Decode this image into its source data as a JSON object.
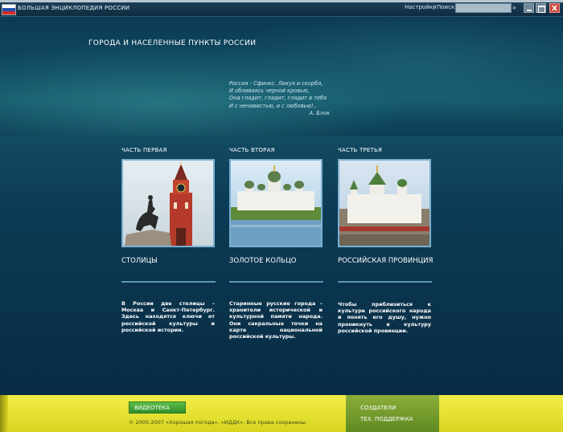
{
  "titlebar": {
    "app_title": "БОЛЬШАЯ ЭНЦИКЛОПЕДИЯ РОССИИ",
    "settings_label": "Настройки",
    "separator": "|",
    "search_label": "Поиск:",
    "search_value": "",
    "search_go": "»"
  },
  "banner": {
    "title": "ГОРОДА И НАСЕЛЕННЫЕ ПУНКТЫ РОССИИ",
    "poem": {
      "lines": [
        "Россия - Сфинкс. Ликуя и скорбя,",
        "И обливаясь черной кровью,",
        "Она глядит, глядит, глядит в тебя",
        "И с ненавистью, и с любовью!.."
      ],
      "author": "А. Блок"
    }
  },
  "sections": [
    {
      "part": "ЧАСТЬ ПЕРВАЯ",
      "heading": "СТОЛИЦЫ",
      "description": "В России две столицы – Москва и Санкт-Петербург. Здесь находятся ключи от российской культуры и российской истории."
    },
    {
      "part": "ЧАСТЬ ВТОРАЯ",
      "heading": "ЗОЛОТОЕ КОЛЬЦО",
      "description": "Старинные русские города – хранители исторической и культурной памяти народа. Они сакральные точки на карте национальной российской культуры."
    },
    {
      "part": "ЧАСТЬ ТРЕТЬЯ",
      "heading": "РОССИЙСКАЯ ПРОВИНЦИЯ",
      "description": "Чтобы приблизиться к культуре российского народа и понять его душу, нужно проникнуть в культуру российской провинции."
    }
  ],
  "footer": {
    "video_button": "ВИДЕОТЕКА",
    "copyright": "© 2005-2007 «Хорошая погода», «ИДДК». Все права сохранены.",
    "links": [
      "СОЗДАТЕЛИ",
      "ТЕХ. ПОДДЕРЖКА"
    ]
  },
  "colors": {
    "background": "#0c3a54",
    "footer_yellow": "#e8e52f",
    "video_button_green": "#3fa535",
    "side_panel_green": "#6f9a2a",
    "picture_border": "#7ab0d2"
  },
  "icons": [
    "russian-flag-icon",
    "minimize-icon",
    "maximize-icon",
    "close-icon"
  ]
}
